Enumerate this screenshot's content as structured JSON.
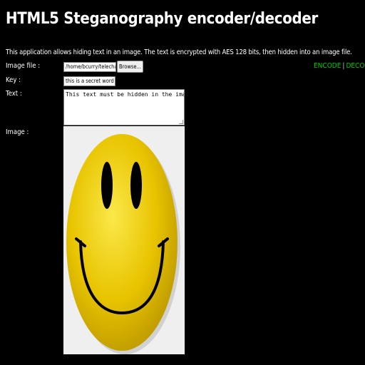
{
  "page": {
    "title": "HTML5 Steganography encoder/decoder",
    "description": "This application allows hiding text in an image. The text is encrypted with AES 128 bits, then hidden into an image file."
  },
  "labels": {
    "image_file": "Image file :",
    "key": "Key :",
    "text": "Text :",
    "image": "Image :"
  },
  "mode": {
    "encode": "ENCODE",
    "separator": "|",
    "decode": "DECODE",
    "color": "#00cc00"
  },
  "form": {
    "file_path": "/home/bcurry/telechargem",
    "browse_label": "Browse...",
    "key_value": "this is a secret word ;)",
    "text_value": "This text must be hidden in the image"
  },
  "image": {
    "subject": "yellow smiley face",
    "face_color": "#e8c400"
  }
}
